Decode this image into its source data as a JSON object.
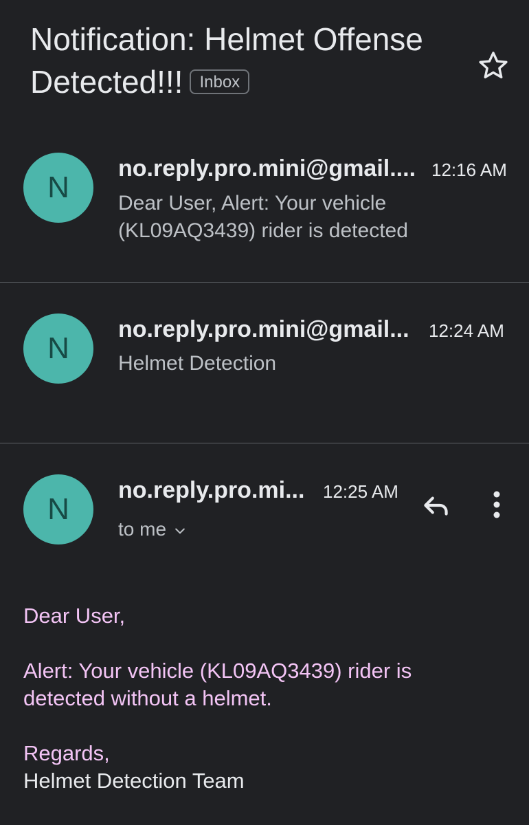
{
  "subject": "Notification: Helmet Offense Detected!!!",
  "label_badge": "Inbox",
  "icons": {
    "star": "star-outline-icon",
    "reply": "reply-icon",
    "more": "more-vert-icon",
    "expand": "chevron-down-icon"
  },
  "messages": [
    {
      "avatar_letter": "N",
      "sender": "no.reply.pro.mini@gmail....",
      "time": "12:16 AM",
      "snippet": "Dear User, Alert: Your vehicle (KL09AQ3439) rider is detected"
    },
    {
      "avatar_letter": "N",
      "sender": "no.reply.pro.mini@gmail...",
      "time": "12:24 AM",
      "snippet": "Helmet Detection"
    },
    {
      "avatar_letter": "N",
      "sender": "no.reply.pro.mi...",
      "time": "12:25 AM",
      "recipient": "to me"
    }
  ],
  "body": {
    "greeting": "Dear User,",
    "alert_line1": "Alert: Your vehicle (KL09AQ3439) rider is",
    "alert_line2": "detected without a helmet.",
    "closing": "Regards,",
    "signature": "Helmet Detection Team"
  },
  "colors": {
    "background": "#202124",
    "avatar": "#4cb6ab",
    "body_text": "#f3c4f5",
    "divider": "#5f6368"
  }
}
